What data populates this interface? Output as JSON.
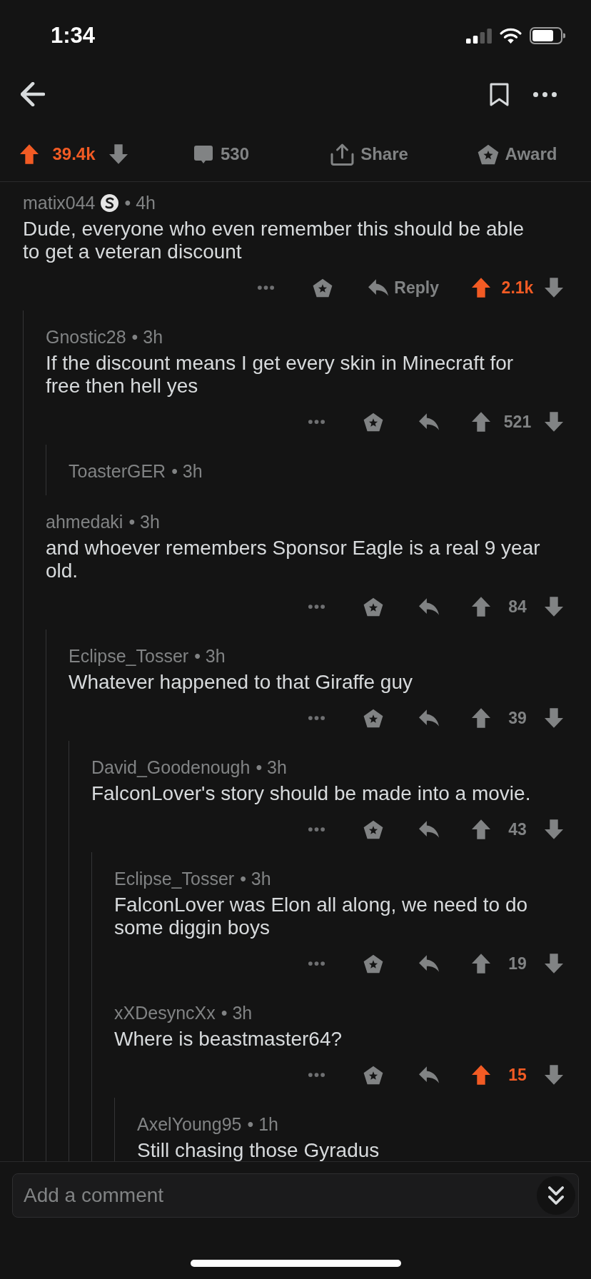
{
  "status_bar": {
    "time": "1:34"
  },
  "post_actions": {
    "upvoted": true,
    "score": "39.4k",
    "comment_count": "530",
    "share_label": "Share",
    "award_label": "Award"
  },
  "comments": [
    {
      "author": "matix044",
      "flair": true,
      "age": "• 4h",
      "collapsed": false,
      "body": "Dude, everyone who even remember this should be able to get a veteran discount",
      "actions": {
        "upvoted": true,
        "score": "2.1k",
        "reply_label": "Reply"
      },
      "children": [
        {
          "author": "Gnostic28",
          "age": "• 3h",
          "collapsed": false,
          "body": "If the discount means I get every skin in Minecraft for free then hell yes",
          "actions": {
            "upvoted": false,
            "score": "521"
          },
          "children": [
            {
              "author": "ToasterGER",
              "age": "• 3h",
              "collapsed": true
            }
          ]
        },
        {
          "author": "ahmedaki",
          "age": "• 3h",
          "collapsed": false,
          "body": "and whoever remembers Sponsor Eagle is a real 9 year old.",
          "actions": {
            "upvoted": false,
            "score": "84"
          },
          "children": [
            {
              "author": "Eclipse_Tosser",
              "age": "• 3h",
              "collapsed": false,
              "body": "Whatever happened to that Giraffe guy",
              "actions": {
                "upvoted": false,
                "score": "39"
              },
              "children": [
                {
                  "author": "David_Goodenough",
                  "age": "• 3h",
                  "collapsed": false,
                  "body": "FalconLover's story should be made into a movie.",
                  "actions": {
                    "upvoted": false,
                    "score": "43"
                  },
                  "children": [
                    {
                      "author": "Eclipse_Tosser",
                      "age": "• 3h",
                      "collapsed": false,
                      "body": "FalconLover was Elon all along, we need to do some diggin boys",
                      "actions": {
                        "upvoted": false,
                        "score": "19"
                      }
                    },
                    {
                      "author": "xXDesyncXx",
                      "age": "• 3h",
                      "collapsed": false,
                      "body": "Where is beastmaster64?",
                      "actions": {
                        "upvoted": true,
                        "score": "15"
                      },
                      "children": [
                        {
                          "author": "AxelYoung95",
                          "age": "• 1h",
                          "collapsed": false,
                          "body": "Still chasing those Gyradus"
                        }
                      ]
                    }
                  ]
                }
              ]
            }
          ]
        }
      ]
    }
  ],
  "comment_box": {
    "placeholder": "Add a comment"
  }
}
